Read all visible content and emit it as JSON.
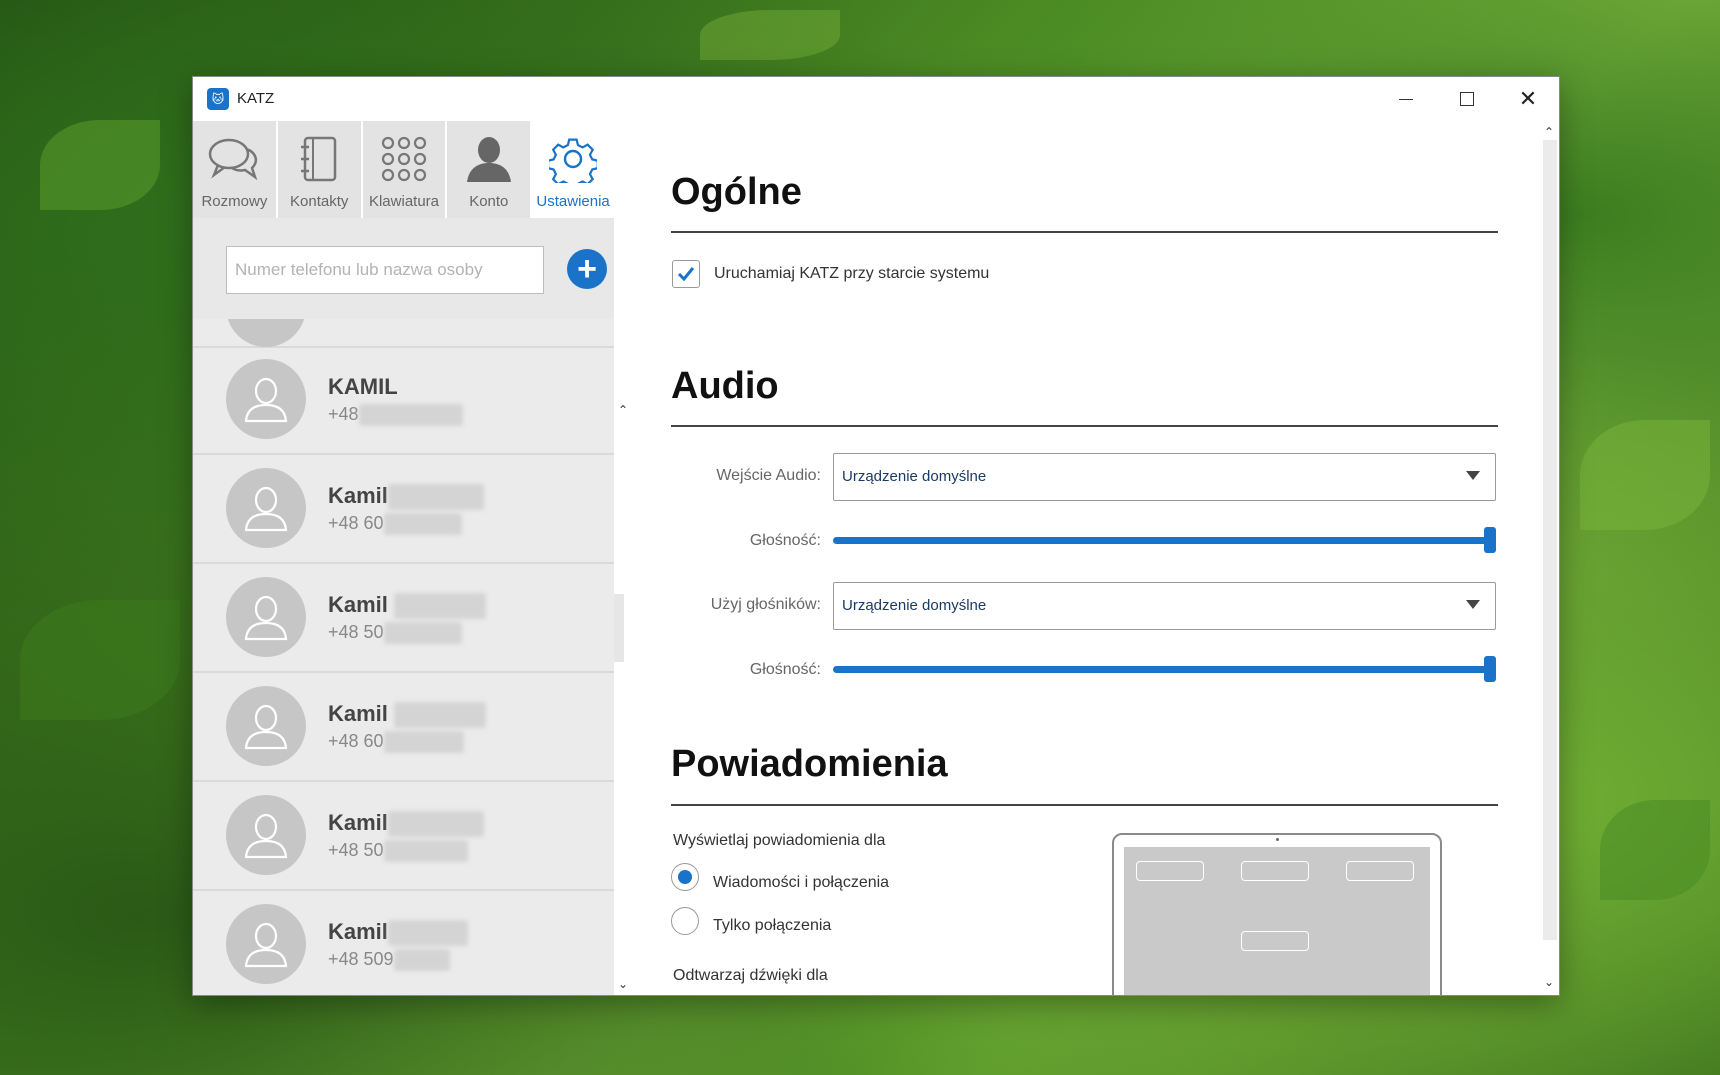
{
  "window": {
    "title": "KATZ",
    "icon_text": "🐱"
  },
  "tabs": [
    {
      "label": "Rozmowy",
      "icon": "chat-bubbles-icon"
    },
    {
      "label": "Kontakty",
      "icon": "address-book-icon"
    },
    {
      "label": "Klawiatura",
      "icon": "dialpad-icon"
    },
    {
      "label": "Konto",
      "icon": "person-icon"
    },
    {
      "label": "Ustawienia",
      "icon": "gear-icon"
    }
  ],
  "search": {
    "placeholder": "Numer telefonu lub nazwa osoby",
    "add_label": "+"
  },
  "contacts": [
    {
      "name": "KAMIL",
      "phone": "+48"
    },
    {
      "name": "Kamil",
      "phone": "+48 60"
    },
    {
      "name": "Kamil",
      "phone": "+48 50"
    },
    {
      "name": "Kamil",
      "phone": "+48 60"
    },
    {
      "name": "Kamil",
      "phone": "+48 50"
    },
    {
      "name": "Kamil",
      "phone": "+48 509"
    }
  ],
  "settings": {
    "general": {
      "title": "Ogólne",
      "autostart_label": "Uruchamiaj KATZ przy starcie systemu",
      "autostart_checked": true
    },
    "audio": {
      "title": "Audio",
      "input_label": "Wejście Audio:",
      "input_value": "Urządzenie domyślne",
      "volume_label": "Głośność:",
      "input_volume": 1.0,
      "output_label": "Użyj głośników:",
      "output_value": "Urządzenie domyślne",
      "output_volume": 1.0
    },
    "notifications": {
      "title": "Powiadomienia",
      "show_for_label": "Wyświetlaj powiadomienia dla",
      "options": [
        {
          "label": "Wiadomości i połączenia",
          "selected": true
        },
        {
          "label": "Tylko połączenia",
          "selected": false
        }
      ],
      "sounds_for_label": "Odtwarzaj dźwięki dla"
    }
  },
  "colors": {
    "accent": "#1a73c8"
  }
}
